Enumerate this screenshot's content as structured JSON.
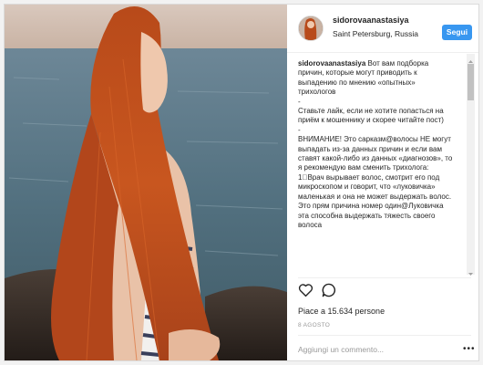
{
  "post": {
    "username": "sidorovaanastasiya",
    "location": "Saint Petersburg, Russia",
    "follow_label": "Segui",
    "caption_user": "sidorovaanastasiya",
    "caption_text": " Вот вам подборка причин, которые могут приводить к выпадению по мнению «опытных» трихологов\n-\nСтавьте лайк, если не хотите попасться на приём к мошеннику и скорее читайте пост)\n-\nВНИМАНИЕ! Это сарказм@волосы НЕ могут выпадать из-за данных причин и если вам ставят какой-либо из данных «диагнозов», то я рекомендую вам сменить трихолога:\n1⃣Врач вырывает волос, смотрит его под микроскопом и говорит, что «луковичка» маленькая и она не может выдержать волос. Это прям причина номер один@Луковичка эта способна выдержать тяжесть своего волоса",
    "likes": "Piace a 15.634 persone",
    "date": "8 AGOSTO",
    "comment_placeholder": "Aggiungi un commento...",
    "more_label": "•••"
  },
  "icons": {
    "like": "heart-outline-icon",
    "comment": "speech-bubble-icon"
  },
  "colors": {
    "accent": "#3897f0",
    "hair": "#c4501c",
    "sea": "#5a7a90"
  }
}
